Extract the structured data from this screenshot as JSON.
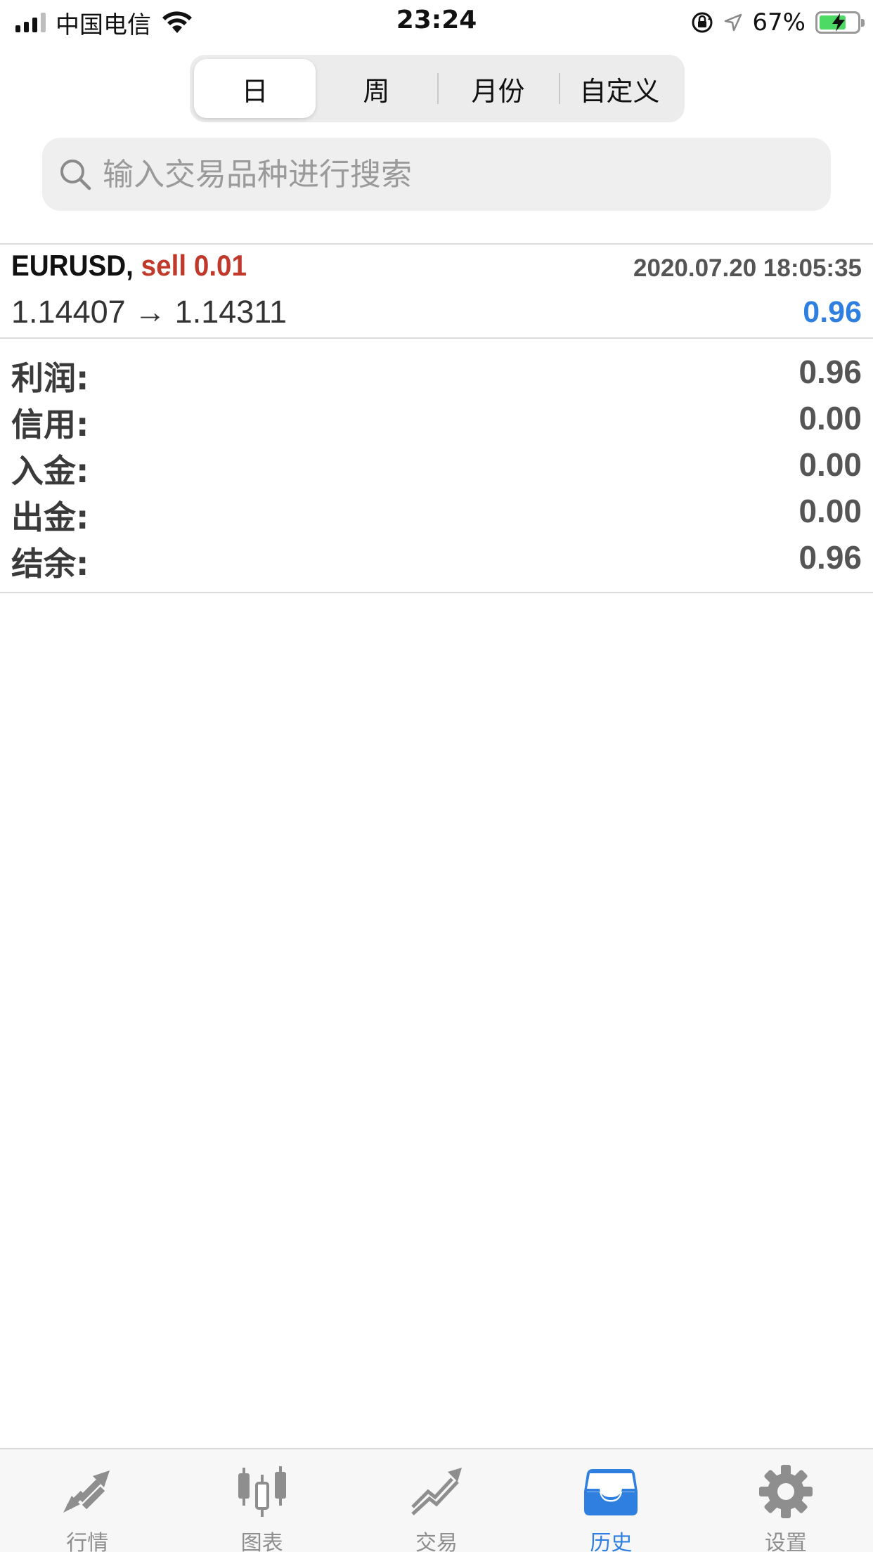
{
  "status_bar": {
    "carrier": "中国电信",
    "time": "23:24",
    "battery_percent": "67%",
    "icons": [
      "signal-icon",
      "wifi-icon",
      "rotation-lock-icon",
      "location-icon",
      "battery-charging-icon"
    ]
  },
  "segments": {
    "items": [
      "日",
      "周",
      "月份",
      "自定义"
    ],
    "selected": "日"
  },
  "search": {
    "placeholder": "输入交易品种进行搜索",
    "value": ""
  },
  "trade": {
    "symbol": "EURUSD,",
    "side_volume": "sell 0.01",
    "time": "2020.07.20 18:05:35",
    "prices": "1.14407 → 1.14311",
    "profit": "0.96"
  },
  "summary": [
    {
      "label": "利润:",
      "value": "0.96"
    },
    {
      "label": "信用:",
      "value": "0.00"
    },
    {
      "label": "入金:",
      "value": "0.00"
    },
    {
      "label": "出金:",
      "value": "0.00"
    },
    {
      "label": "结余:",
      "value": "0.96"
    }
  ],
  "tabbar": {
    "items": [
      {
        "label": "行情",
        "icon": "quotes-arrows-icon"
      },
      {
        "label": "图表",
        "icon": "candlestick-icon"
      },
      {
        "label": "交易",
        "icon": "trade-chart-icon"
      },
      {
        "label": "历史",
        "icon": "history-tray-icon"
      },
      {
        "label": "设置",
        "icon": "gear-icon"
      }
    ],
    "active": "历史"
  },
  "colors": {
    "accent": "#2f7fe0",
    "sell": "#c0392b",
    "battery": "#4cd964",
    "tab_inactive": "#8e8e8e"
  }
}
